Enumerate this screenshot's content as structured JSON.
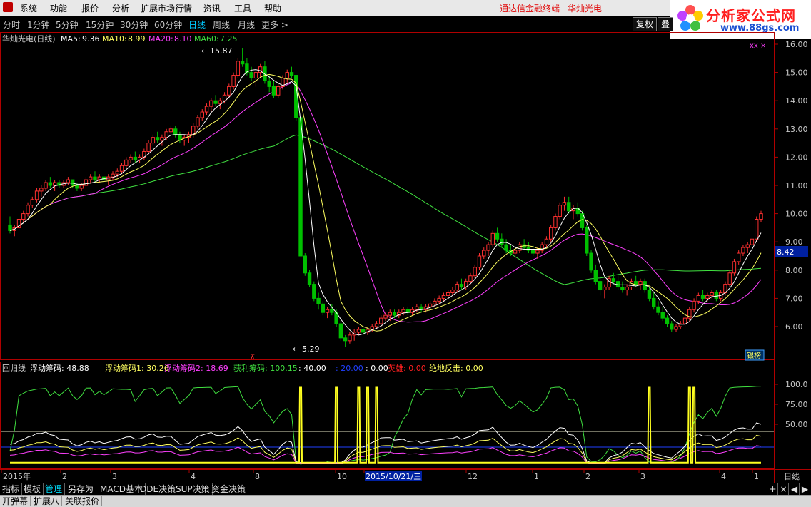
{
  "menu": {
    "items": [
      "系统",
      "功能",
      "报价",
      "分析",
      "扩展市场行情",
      "资讯",
      "工具",
      "帮助"
    ],
    "brand": "通达信金融终端",
    "stock": "华灿光电"
  },
  "logo": {
    "title": "分析家公式网",
    "url": "www.88gs.com"
  },
  "periods": {
    "items": [
      "分时",
      "1分钟",
      "5分钟",
      "15分钟",
      "30分钟",
      "60分钟",
      "日线",
      "周线",
      "月线",
      "更多 >"
    ],
    "active": "日线",
    "right_buttons": [
      "复权",
      "叠"
    ]
  },
  "main_chart": {
    "stock_label": "华灿光电(日线)",
    "ma": [
      {
        "label": "MA5:",
        "value": "9.36",
        "color": "#ffffff"
      },
      {
        "label": "MA10:",
        "value": "8.99",
        "color": "#ffff60"
      },
      {
        "label": "MA20:",
        "value": "8.10",
        "color": "#ff40ff"
      },
      {
        "label": "MA60:",
        "value": "7.25",
        "color": "#40e040"
      }
    ],
    "y_ticks": [
      "16.00",
      "15.00",
      "14.00",
      "13.00",
      "12.00",
      "11.00",
      "10.00",
      "9.00",
      "8.00",
      "7.00",
      "6.00"
    ],
    "price_tag": "8.42",
    "high_label": "15.87",
    "low_label": "5.29",
    "badge": "银榜",
    "marker": "xx ×"
  },
  "indicator": {
    "name": "回归线",
    "items": [
      {
        "label": "浮动筹码:",
        "value": "48.88",
        "color": "#ffffff"
      },
      {
        "label": "浮动筹码1:",
        "value": "30.26",
        "color": "#ffff60"
      },
      {
        "label": "浮动筹码2:",
        "value": "18.69",
        "color": "#ff40ff"
      },
      {
        "label": "获利筹码:",
        "value": "100.15",
        "color": "#40e040"
      },
      {
        "label": "",
        "value": "40.00",
        "color": "#ffffff"
      },
      {
        "label": "",
        "value": "20.00",
        "color": "#2040ff"
      },
      {
        "label": "",
        "value": "0.00",
        "color": "#ffffff"
      },
      {
        "label": "英雄:",
        "value": "0.00",
        "color": "#ff2020"
      },
      {
        "label": "绝地反击:",
        "value": "0.00",
        "color": "#ffff60"
      }
    ],
    "y_ticks": [
      "100.0",
      "75.00",
      "50.00"
    ]
  },
  "x_axis": {
    "labels": [
      "2015年",
      "2",
      "3",
      "4",
      "8",
      "10",
      "2015/10/21/三",
      "12",
      "1",
      "2",
      "3",
      "4",
      "1"
    ],
    "right_label": "日线"
  },
  "bottom_tabs": [
    "指标",
    "模板",
    "管理",
    "另存为",
    "MACD基本",
    "DDE决策",
    "SUP决策",
    "资金决策"
  ],
  "bottom_active": "管理",
  "bottom_controls": [
    "+",
    "×",
    "◀",
    "▶"
  ],
  "bottom_tabs2": [
    "开弹幕",
    "扩展八",
    "关联报价"
  ],
  "chart_data": {
    "type": "candlestick",
    "ylim": [
      5.0,
      16.2
    ],
    "ohlc": [
      [
        9.6,
        9.9,
        9.3,
        9.4
      ],
      [
        9.4,
        9.6,
        9.2,
        9.5
      ],
      [
        9.5,
        9.9,
        9.4,
        9.8
      ],
      [
        9.8,
        10.1,
        9.7,
        10.0
      ],
      [
        10.0,
        10.4,
        9.9,
        10.3
      ],
      [
        10.3,
        10.6,
        10.2,
        10.5
      ],
      [
        10.5,
        10.9,
        10.4,
        10.8
      ],
      [
        10.8,
        11.0,
        10.6,
        10.9
      ],
      [
        10.9,
        11.2,
        10.8,
        11.1
      ],
      [
        11.1,
        11.3,
        10.9,
        11.0
      ],
      [
        11.0,
        11.2,
        10.8,
        11.1
      ],
      [
        11.1,
        11.2,
        10.9,
        11.0
      ],
      [
        11.0,
        11.2,
        10.9,
        11.1
      ],
      [
        11.1,
        11.3,
        11.0,
        11.2
      ],
      [
        11.2,
        11.2,
        10.9,
        11.0
      ],
      [
        11.0,
        11.1,
        10.8,
        10.9
      ],
      [
        10.9,
        11.1,
        10.8,
        11.0
      ],
      [
        11.0,
        11.3,
        10.9,
        11.2
      ],
      [
        11.2,
        11.4,
        11.1,
        11.3
      ],
      [
        11.3,
        11.5,
        11.1,
        11.2
      ],
      [
        11.2,
        11.4,
        11.1,
        11.3
      ],
      [
        11.3,
        11.4,
        11.1,
        11.2
      ],
      [
        11.2,
        11.4,
        11.0,
        11.3
      ],
      [
        11.3,
        11.5,
        11.2,
        11.4
      ],
      [
        11.4,
        11.6,
        11.3,
        11.5
      ],
      [
        11.5,
        11.8,
        11.4,
        11.7
      ],
      [
        11.7,
        12.0,
        11.6,
        11.9
      ],
      [
        11.9,
        12.1,
        11.8,
        12.0
      ],
      [
        12.0,
        12.2,
        11.8,
        11.9
      ],
      [
        11.9,
        12.1,
        11.8,
        12.0
      ],
      [
        12.0,
        12.3,
        11.9,
        12.2
      ],
      [
        12.2,
        12.6,
        12.1,
        12.5
      ],
      [
        12.5,
        12.8,
        12.4,
        12.7
      ],
      [
        12.7,
        12.9,
        12.5,
        12.6
      ],
      [
        12.6,
        12.8,
        12.4,
        12.7
      ],
      [
        12.7,
        13.0,
        12.6,
        12.9
      ],
      [
        12.9,
        13.1,
        12.8,
        13.0
      ],
      [
        13.0,
        13.1,
        12.7,
        12.8
      ],
      [
        12.8,
        12.9,
        12.5,
        12.6
      ],
      [
        12.6,
        12.8,
        12.4,
        12.7
      ],
      [
        12.7,
        12.9,
        12.5,
        12.8
      ],
      [
        12.8,
        13.2,
        12.7,
        13.1
      ],
      [
        13.1,
        13.5,
        13.0,
        13.4
      ],
      [
        13.4,
        13.7,
        13.3,
        13.6
      ],
      [
        13.6,
        13.9,
        13.5,
        13.8
      ],
      [
        13.8,
        14.1,
        13.6,
        14.0
      ],
      [
        14.0,
        14.2,
        13.8,
        13.9
      ],
      [
        13.9,
        14.1,
        13.7,
        14.0
      ],
      [
        14.0,
        14.3,
        13.9,
        14.2
      ],
      [
        14.2,
        14.6,
        14.1,
        14.5
      ],
      [
        14.5,
        15.0,
        14.4,
        14.9
      ],
      [
        14.9,
        15.5,
        14.8,
        15.4
      ],
      [
        15.4,
        15.87,
        15.2,
        15.3
      ],
      [
        15.3,
        15.5,
        14.9,
        15.0
      ],
      [
        15.0,
        15.2,
        14.7,
        14.8
      ],
      [
        14.8,
        15.1,
        14.5,
        15.0
      ],
      [
        15.0,
        15.3,
        14.8,
        15.2
      ],
      [
        15.2,
        15.4,
        14.6,
        14.7
      ],
      [
        14.7,
        14.9,
        14.3,
        14.5
      ],
      [
        14.5,
        14.7,
        14.1,
        14.2
      ],
      [
        14.2,
        14.6,
        14.1,
        14.5
      ],
      [
        14.5,
        14.9,
        14.4,
        14.8
      ],
      [
        14.8,
        15.1,
        14.6,
        15.0
      ],
      [
        15.0,
        15.2,
        14.8,
        14.9
      ],
      [
        14.9,
        14.9,
        13.3,
        13.4
      ],
      [
        13.4,
        13.4,
        8.5,
        8.5
      ],
      [
        8.5,
        8.6,
        7.8,
        7.9
      ],
      [
        7.9,
        8.0,
        7.4,
        7.5
      ],
      [
        7.5,
        7.6,
        6.9,
        7.0
      ],
      [
        7.0,
        7.2,
        6.6,
        6.8
      ],
      [
        6.8,
        6.9,
        6.4,
        6.5
      ],
      [
        6.5,
        6.7,
        6.3,
        6.6
      ],
      [
        6.6,
        6.8,
        6.4,
        6.5
      ],
      [
        6.5,
        6.6,
        6.0,
        6.1
      ],
      [
        6.1,
        6.2,
        5.5,
        5.6
      ],
      [
        5.6,
        5.7,
        5.29,
        5.5
      ],
      [
        5.5,
        5.8,
        5.4,
        5.7
      ],
      [
        5.7,
        5.9,
        5.5,
        5.8
      ],
      [
        5.8,
        6.0,
        5.7,
        5.9
      ],
      [
        5.9,
        6.0,
        5.7,
        5.8
      ],
      [
        5.8,
        6.0,
        5.7,
        5.9
      ],
      [
        5.9,
        6.1,
        5.8,
        6.0
      ],
      [
        6.0,
        6.2,
        5.9,
        6.1
      ],
      [
        6.1,
        6.4,
        6.0,
        6.3
      ],
      [
        6.3,
        6.5,
        6.2,
        6.4
      ],
      [
        6.4,
        6.6,
        6.2,
        6.5
      ],
      [
        6.5,
        6.6,
        6.3,
        6.4
      ],
      [
        6.4,
        6.6,
        6.3,
        6.5
      ],
      [
        6.5,
        6.7,
        6.4,
        6.6
      ],
      [
        6.6,
        6.7,
        6.4,
        6.5
      ],
      [
        6.5,
        6.7,
        6.4,
        6.6
      ],
      [
        6.6,
        6.8,
        6.5,
        6.7
      ],
      [
        6.7,
        6.8,
        6.5,
        6.6
      ],
      [
        6.6,
        6.8,
        6.5,
        6.7
      ],
      [
        6.7,
        6.9,
        6.6,
        6.8
      ],
      [
        6.8,
        7.0,
        6.7,
        6.9
      ],
      [
        6.9,
        7.1,
        6.8,
        7.0
      ],
      [
        7.0,
        7.2,
        6.9,
        7.1
      ],
      [
        7.1,
        7.3,
        7.0,
        7.2
      ],
      [
        7.2,
        7.4,
        7.1,
        7.3
      ],
      [
        7.3,
        7.6,
        7.2,
        7.5
      ],
      [
        7.5,
        7.7,
        7.3,
        7.4
      ],
      [
        7.4,
        7.7,
        7.3,
        7.6
      ],
      [
        7.6,
        7.9,
        7.5,
        7.8
      ],
      [
        7.8,
        8.2,
        7.7,
        8.1
      ],
      [
        8.1,
        8.6,
        8.0,
        8.5
      ],
      [
        8.5,
        8.8,
        8.4,
        8.7
      ],
      [
        8.7,
        9.0,
        8.5,
        8.9
      ],
      [
        8.9,
        9.4,
        8.8,
        9.3
      ],
      [
        9.3,
        9.5,
        9.0,
        9.1
      ],
      [
        9.1,
        9.3,
        8.8,
        8.9
      ],
      [
        8.9,
        9.1,
        8.6,
        8.7
      ],
      [
        8.7,
        8.9,
        8.5,
        8.6
      ],
      [
        8.6,
        8.8,
        8.4,
        8.7
      ],
      [
        8.7,
        9.0,
        8.6,
        8.9
      ],
      [
        8.9,
        9.1,
        8.7,
        8.8
      ],
      [
        8.8,
        9.0,
        8.6,
        8.7
      ],
      [
        8.7,
        8.9,
        8.5,
        8.6
      ],
      [
        8.6,
        8.8,
        8.4,
        8.7
      ],
      [
        8.7,
        9.0,
        8.6,
        8.9
      ],
      [
        8.9,
        9.2,
        8.8,
        9.1
      ],
      [
        9.1,
        9.6,
        9.0,
        9.5
      ],
      [
        9.5,
        10.0,
        9.4,
        9.9
      ],
      [
        9.9,
        10.4,
        9.8,
        10.3
      ],
      [
        10.3,
        10.6,
        10.1,
        10.4
      ],
      [
        10.4,
        10.6,
        10.0,
        10.1
      ],
      [
        10.1,
        10.3,
        9.8,
        10.2
      ],
      [
        10.2,
        10.4,
        9.9,
        10.0
      ],
      [
        10.0,
        10.1,
        9.4,
        9.5
      ],
      [
        9.5,
        9.6,
        8.5,
        8.6
      ],
      [
        8.6,
        8.7,
        7.9,
        8.0
      ],
      [
        8.0,
        8.2,
        7.5,
        7.6
      ],
      [
        7.6,
        7.8,
        7.1,
        7.3
      ],
      [
        7.3,
        7.5,
        7.0,
        7.4
      ],
      [
        7.4,
        7.8,
        7.3,
        7.7
      ],
      [
        7.7,
        7.9,
        7.5,
        7.6
      ],
      [
        7.6,
        7.8,
        7.3,
        7.4
      ],
      [
        7.4,
        7.6,
        7.2,
        7.3
      ],
      [
        7.3,
        7.5,
        7.1,
        7.4
      ],
      [
        7.4,
        7.7,
        7.3,
        7.6
      ],
      [
        7.6,
        7.8,
        7.4,
        7.5
      ],
      [
        7.5,
        7.7,
        7.3,
        7.6
      ],
      [
        7.6,
        7.7,
        7.2,
        7.3
      ],
      [
        7.3,
        7.4,
        6.9,
        7.0
      ],
      [
        7.0,
        7.2,
        6.6,
        6.7
      ],
      [
        6.7,
        6.9,
        6.4,
        6.5
      ],
      [
        6.5,
        6.7,
        6.2,
        6.3
      ],
      [
        6.3,
        6.4,
        6.0,
        6.1
      ],
      [
        6.1,
        6.2,
        5.8,
        5.9
      ],
      [
        5.9,
        6.1,
        5.8,
        6.0
      ],
      [
        6.0,
        6.2,
        5.9,
        6.1
      ],
      [
        6.1,
        6.4,
        6.0,
        6.3
      ],
      [
        6.3,
        6.7,
        6.2,
        6.6
      ],
      [
        6.6,
        7.0,
        6.5,
        6.9
      ],
      [
        6.9,
        7.2,
        6.8,
        7.1
      ],
      [
        7.1,
        7.3,
        6.9,
        7.0
      ],
      [
        7.0,
        7.2,
        6.9,
        7.1
      ],
      [
        7.1,
        7.3,
        7.0,
        7.2
      ],
      [
        7.2,
        7.3,
        6.9,
        7.0
      ],
      [
        7.0,
        7.3,
        6.9,
        7.2
      ],
      [
        7.2,
        7.6,
        7.1,
        7.5
      ],
      [
        7.5,
        8.0,
        7.4,
        7.9
      ],
      [
        7.9,
        8.4,
        7.8,
        8.3
      ],
      [
        8.3,
        8.7,
        8.2,
        8.6
      ],
      [
        8.6,
        8.9,
        8.5,
        8.8
      ],
      [
        8.8,
        9.0,
        8.6,
        8.9
      ],
      [
        8.9,
        9.2,
        8.8,
        9.1
      ],
      [
        9.1,
        9.9,
        9.0,
        9.8
      ],
      [
        9.8,
        10.1,
        9.7,
        10.0
      ]
    ]
  }
}
